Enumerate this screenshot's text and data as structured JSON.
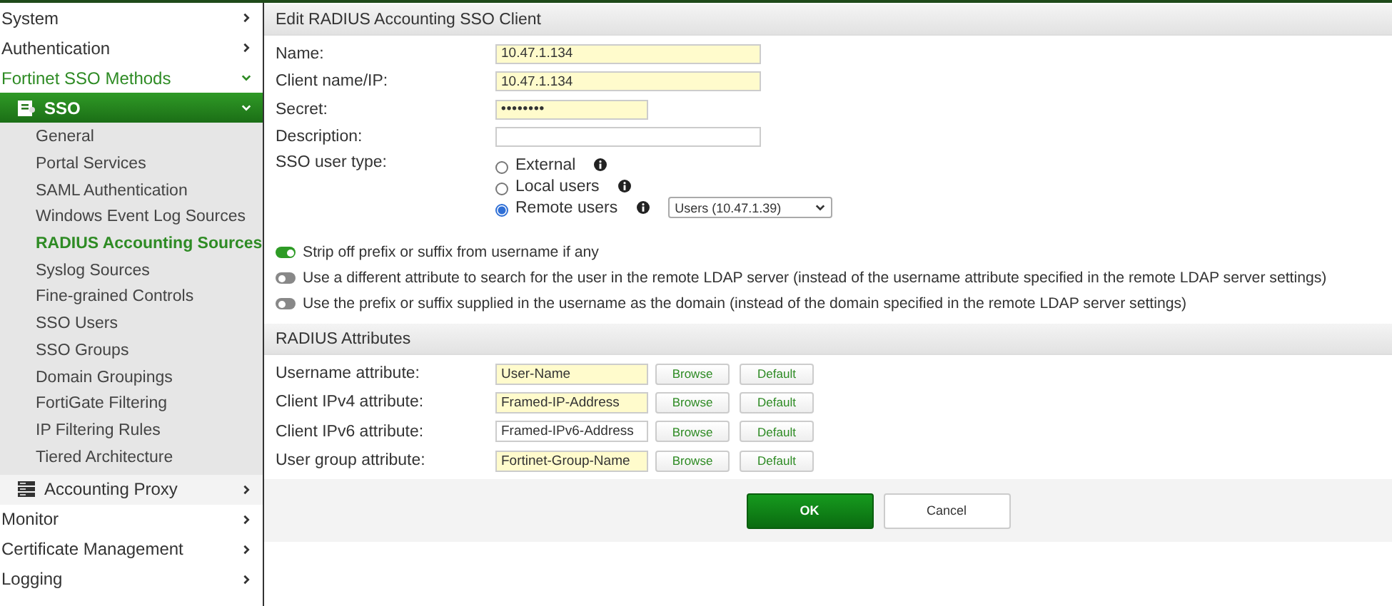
{
  "sidebar": {
    "items": [
      {
        "label": "System",
        "expanded": false
      },
      {
        "label": "Authentication",
        "expanded": false
      },
      {
        "label": "Fortinet SSO Methods",
        "expanded": true,
        "children": [
          {
            "label": "SSO",
            "kind": "document",
            "expanded": true,
            "children": [
              {
                "label": "General",
                "selected": false
              },
              {
                "label": "Portal Services",
                "selected": false
              },
              {
                "label": "SAML Authentication",
                "selected": false
              },
              {
                "label": "Windows Event Log Sources",
                "selected": false
              },
              {
                "label": "RADIUS Accounting Sources",
                "selected": true
              },
              {
                "label": "Syslog Sources",
                "selected": false
              },
              {
                "label": "Fine-grained Controls",
                "selected": false
              },
              {
                "label": "SSO Users",
                "selected": false
              },
              {
                "label": "SSO Groups",
                "selected": false
              },
              {
                "label": "Domain Groupings",
                "selected": false
              },
              {
                "label": "FortiGate Filtering",
                "selected": false
              },
              {
                "label": "IP Filtering Rules",
                "selected": false
              },
              {
                "label": "Tiered Architecture",
                "selected": false
              }
            ]
          },
          {
            "label": "Accounting Proxy",
            "kind": "server",
            "expanded": false
          }
        ]
      },
      {
        "label": "Monitor",
        "expanded": false
      },
      {
        "label": "Certificate Management",
        "expanded": false
      },
      {
        "label": "Logging",
        "expanded": false
      }
    ]
  },
  "form": {
    "title": "Edit RADIUS Accounting SSO Client",
    "fields": [
      {
        "label": "Name:",
        "value": "10.47.1.134",
        "kind": "text",
        "highlighted": true
      },
      {
        "label": "Client name/IP:",
        "value": "10.47.1.134",
        "kind": "text",
        "highlighted": true
      },
      {
        "label": "Secret:",
        "value": "••••••••",
        "kind": "password",
        "highlighted": true
      },
      {
        "label": "Description:",
        "kind": "text",
        "highlighted": false
      }
    ],
    "user_type": {
      "label": "SSO user type:",
      "options": [
        {
          "label": "External",
          "selected": false
        },
        {
          "label": "Local users",
          "selected": false
        },
        {
          "label": "Remote users",
          "selected": true,
          "dropdown": "Users (10.47.1.39)"
        }
      ]
    },
    "toggles": [
      {
        "label": "Strip off prefix or suffix from username if any",
        "on": true
      },
      {
        "label": "Use a different attribute to search for the user in the remote LDAP server (instead of the username attribute specified in the remote LDAP server settings)",
        "on": false
      },
      {
        "label": "Use the prefix or suffix supplied in the username as the domain (instead of the domain specified in the remote LDAP server settings)",
        "on": false
      }
    ],
    "attributes": {
      "title": "RADIUS Attributes",
      "rows": [
        {
          "label": "Username attribute:",
          "value": "User-Name",
          "highlighted": true,
          "buttons": [
            "Browse",
            "Default"
          ]
        },
        {
          "label": "Client IPv4 attribute:",
          "value": "Framed-IP-Address",
          "highlighted": true,
          "buttons": [
            "Browse",
            "Default"
          ]
        },
        {
          "label": "Client IPv6 attribute:",
          "value": "Framed-IPv6-Address",
          "highlighted": false,
          "buttons": [
            "Browse",
            "Default"
          ]
        },
        {
          "label": "User group attribute:",
          "value": "Fortinet-Group-Name",
          "highlighted": true,
          "buttons": [
            "Browse",
            "Default"
          ]
        }
      ]
    },
    "buttons": [
      {
        "label": "OK",
        "kind": "primary"
      },
      {
        "label": "Cancel",
        "kind": "secondary"
      }
    ]
  }
}
